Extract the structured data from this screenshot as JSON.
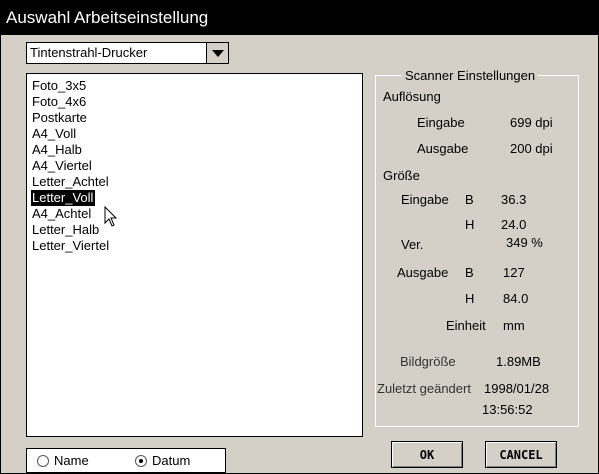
{
  "window": {
    "title": "Auswahl Arbeitseinstellung"
  },
  "printer_select": {
    "value": "Tintenstrahl-Drucker",
    "icon": "chevron-down-icon"
  },
  "preset_list": {
    "items": [
      "Foto_3x5",
      "Foto_4x6",
      "Postkarte",
      "A4_Voll",
      "A4_Halb",
      "A4_Viertel",
      "Letter_Achtel",
      "Letter_Voll",
      "A4_Achtel",
      "Letter_Halb",
      "Letter_Viertel"
    ],
    "selected": "Letter_Voll"
  },
  "scanner": {
    "legend": "Scanner Einstellungen",
    "aufloesung_label": "Auflösung",
    "eingabe_label": "Eingabe",
    "eingabe_dpi": "699 dpi",
    "ausgabe_label": "Ausgabe",
    "ausgabe_dpi": "200 dpi",
    "groesse_label": "Größe",
    "groesse_eingabe_label": "Eingabe",
    "b_label": "B",
    "eingabe_b": "36.3",
    "h_label": "H",
    "eingabe_h": "24.0",
    "ver_label": "Ver.",
    "ver_value": "349 %",
    "groesse_ausgabe_label": "Ausgabe",
    "b2_label": "B",
    "ausgabe_b": "127",
    "h2_label": "H",
    "ausgabe_h": "84.0",
    "einheit_label": "Einheit",
    "einheit_value": "mm",
    "bildgroesse_label": "Bildgröße",
    "bildgroesse_value": "1.89MB",
    "zuletzt_label": "Zuletzt geändert",
    "zuletzt_date": "1998/01/28",
    "zuletzt_time": "13:56:52"
  },
  "sort": {
    "name_label": "Name",
    "datum_label": "Datum",
    "selected": "Datum"
  },
  "buttons": {
    "ok": "OK",
    "cancel": "CANCEL"
  }
}
